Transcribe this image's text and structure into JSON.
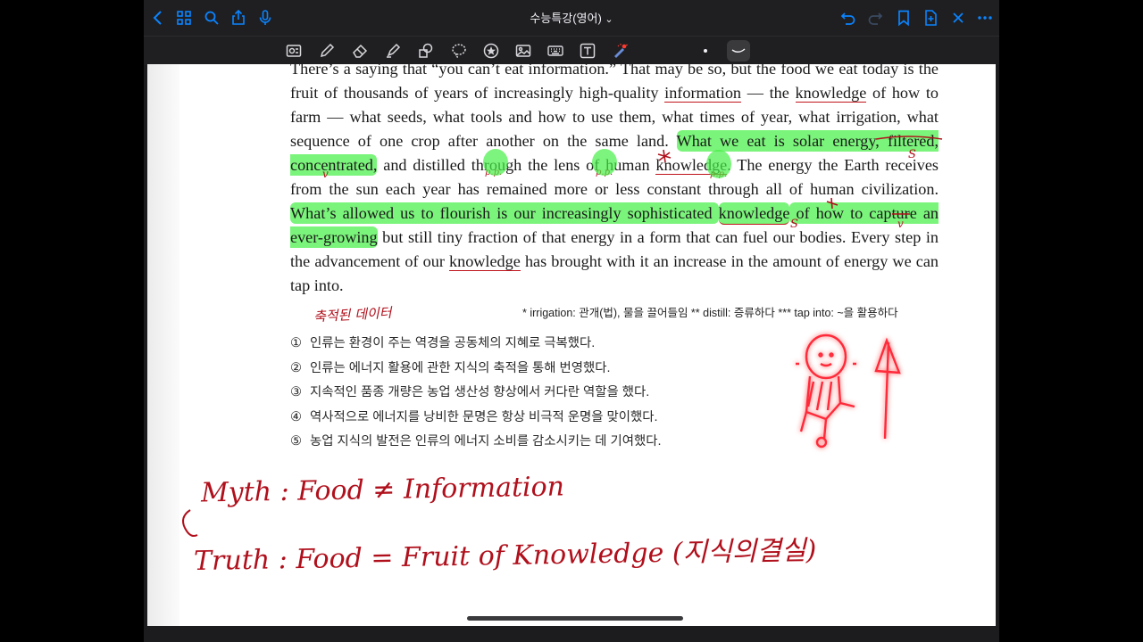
{
  "document_title": "수능특강(영어)",
  "title_chevron": "⌄",
  "passage": {
    "line1": "There’s a saying that “you can’t eat information.” That may be so, but the food we eat today is the fruit of thousands of years of increasingly high-quality ",
    "w_information": "information",
    "s_after_information": " — the ",
    "w_knowledge1": "knowledge",
    "s2": " of how to farm — what seeds, what tools and how to use them, what times of year, what irrigation, what sequence of one crop after another on the same land. ",
    "h1": "What we eat is solar energy, filtered, concentrated,",
    "s3": " and distilled through the lens of human ",
    "w_knowledge2": "knowledge",
    "s4": ". The energy the Earth receives from the sun each year has remained more or less constant through all of human civilization. ",
    "h2a": "What’s allowed us to flourish is our increasingly sophisticated ",
    "w_knowledge3": "knowledge",
    "h2b": " of how to capture an ever-growing",
    "s5": " but still tiny fraction of that energy in a form that can fuel our bodies. Every step in the advancement of our ",
    "w_knowledge4": "knowledge",
    "s6": " has brought with it an increase in the amount of energy we can tap into."
  },
  "footnote": "* irrigation: 관개(법), 물을 끌어들임   ** distill: 증류하다   *** tap into: ~을 활용하다",
  "choices": [
    {
      "num": "①",
      "text": "인류는 환경이 주는 역경을 공동체의 지혜로 극복했다."
    },
    {
      "num": "②",
      "text": "인류는 에너지 활용에 관한 지식의 축적을 통해 번영했다."
    },
    {
      "num": "③",
      "text": "지속적인 품종 개량은 농업 생산성 향상에서 커다란 역할을 했다."
    },
    {
      "num": "④",
      "text": "역사적으로 에너지를 낭비한 문명은 항상 비극적 운명을 맞이했다."
    },
    {
      "num": "⑤",
      "text": "농업 지식의 발전은 인류의 에너지 소비를 감소시키는 데 기여했다."
    }
  ],
  "handwriting": {
    "note_data": "축적된 데이터",
    "pp1": "p.p.",
    "pp2": "p.p.",
    "pp3": "p.p.",
    "v1": "v",
    "v2": "v",
    "s1": "S",
    "s2": "S",
    "myth": "Myth : Food ≠ Information",
    "truth": "Truth : Food = Fruit of Knowledge (지식의결실)"
  },
  "colors": {
    "accent": "#0a84ff",
    "ink": "#b0101c",
    "highlight": "#46f046",
    "neon": "#ff2a3a"
  }
}
